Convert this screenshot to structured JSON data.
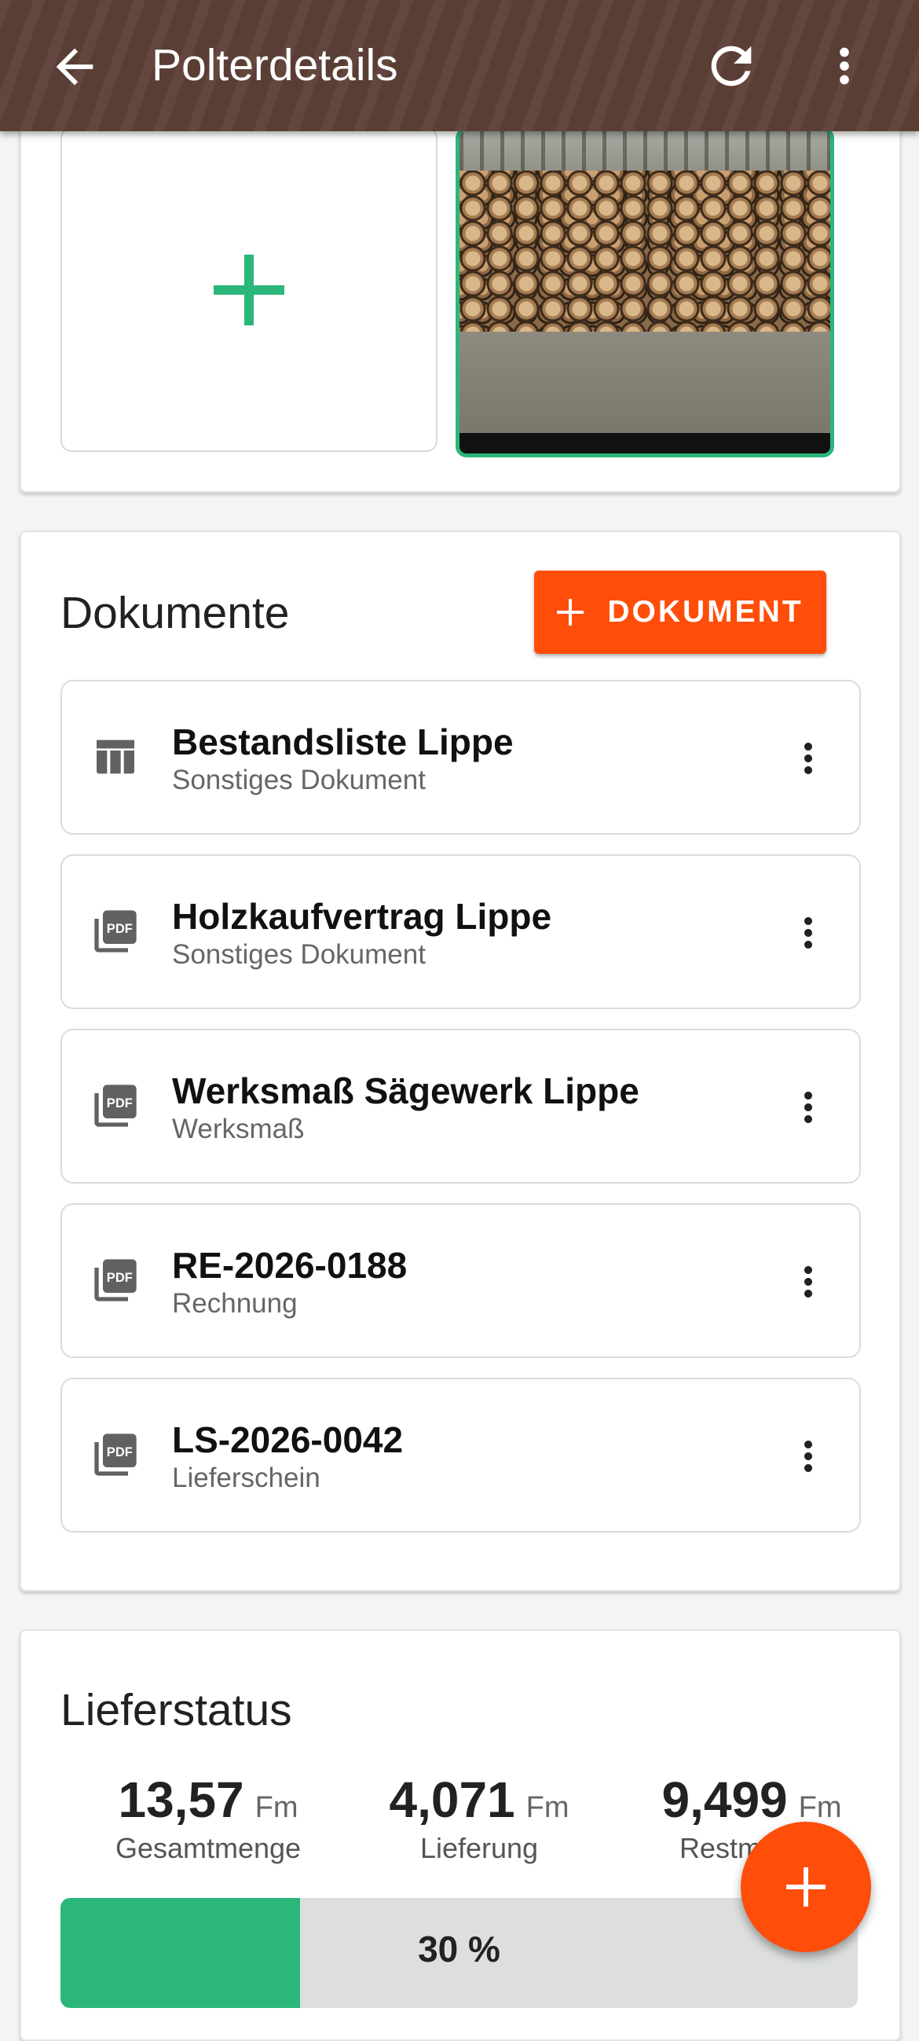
{
  "appbar": {
    "title": "Polterdetails",
    "back_icon": "arrow-back-icon",
    "refresh_icon": "refresh-icon",
    "more_icon": "more-vert-icon",
    "background": "#5d4037"
  },
  "photos": {
    "add_icon": "plus-icon",
    "thumbnail_icon": "photo-log-pile"
  },
  "documents": {
    "title": "Dokumente",
    "add_button_label": "DOKUMENT",
    "items": [
      {
        "name": "Bestandsliste Lippe",
        "type": "Sonstiges Dokument",
        "icon": "table-icon"
      },
      {
        "name": "Holzkaufvertrag Lippe",
        "type": "Sonstiges Dokument",
        "icon": "pdf-icon"
      },
      {
        "name": "Werksmaß Sägewerk Lippe",
        "type": "Werksmaß",
        "icon": "pdf-icon"
      },
      {
        "name": "RE-2026-0188",
        "type": "Rechnung",
        "icon": "pdf-icon"
      },
      {
        "name": "LS-2026-0042",
        "type": "Lieferschein",
        "icon": "pdf-icon"
      }
    ]
  },
  "delivery": {
    "title": "Lieferstatus",
    "total": {
      "value": "13,57",
      "unit": "Fm",
      "label": "Gesamtmenge"
    },
    "delivered": {
      "value": "4,071",
      "unit": "Fm",
      "label": "Lieferung"
    },
    "remaining": {
      "value": "9,499",
      "unit": "Fm",
      "label": "Restmenge"
    },
    "progress_percent": 30,
    "progress_label": "30 %"
  },
  "fab": {
    "icon": "plus-icon"
  },
  "colors": {
    "accent": "#ff4d0a",
    "success": "#2bb77a"
  }
}
